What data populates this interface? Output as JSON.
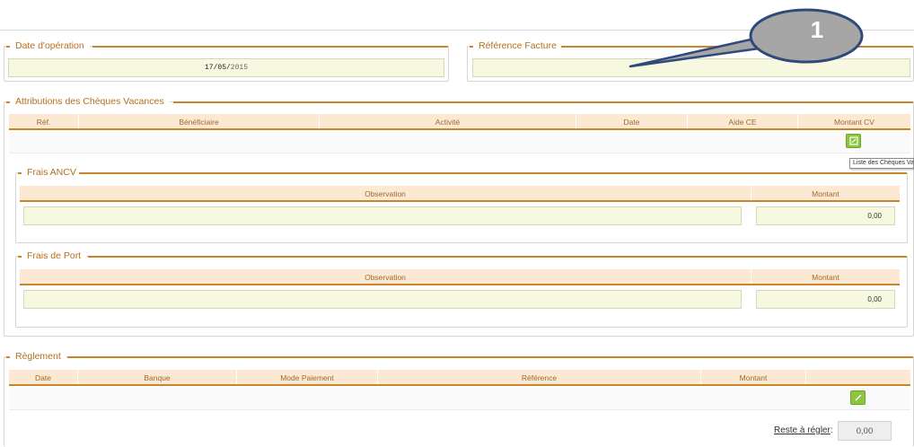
{
  "callout": {
    "number": "1"
  },
  "operation": {
    "legend": "Date d'opération",
    "date_day": "17/05/",
    "date_year": "2015"
  },
  "reference": {
    "legend": "Référence Facture",
    "value": ""
  },
  "attributions": {
    "legend": "Attributions des Chèques Vacances",
    "columns": [
      "Réf.",
      "Bénéficiaire",
      "Activité",
      "Date",
      "Aide CE",
      "Montant CV"
    ],
    "tooltip": "Liste des Chèques Vacances"
  },
  "frais_ancv": {
    "legend": "Frais ANCV",
    "columns": [
      "Observation",
      "Montant"
    ],
    "observation": "",
    "montant": "0,00"
  },
  "frais_port": {
    "legend": "Frais de Port",
    "columns": [
      "Observation",
      "Montant"
    ],
    "observation": "",
    "montant": "0,00"
  },
  "reglement": {
    "legend": "Règlement",
    "columns": [
      "Date",
      "Banque",
      "Mode Paiement",
      "Référence",
      "Montant",
      ""
    ],
    "reste_label": "Reste à régler",
    "reste_colon": ":",
    "reste_value": "0,00"
  },
  "colors": {
    "accent": "#c8862c",
    "header_bg": "#fbe9d4",
    "field_bg": "#f6f8df",
    "button_green": "#8cc63f",
    "callout_fill": "#a6a6a6",
    "callout_border": "#2f4a7a"
  }
}
